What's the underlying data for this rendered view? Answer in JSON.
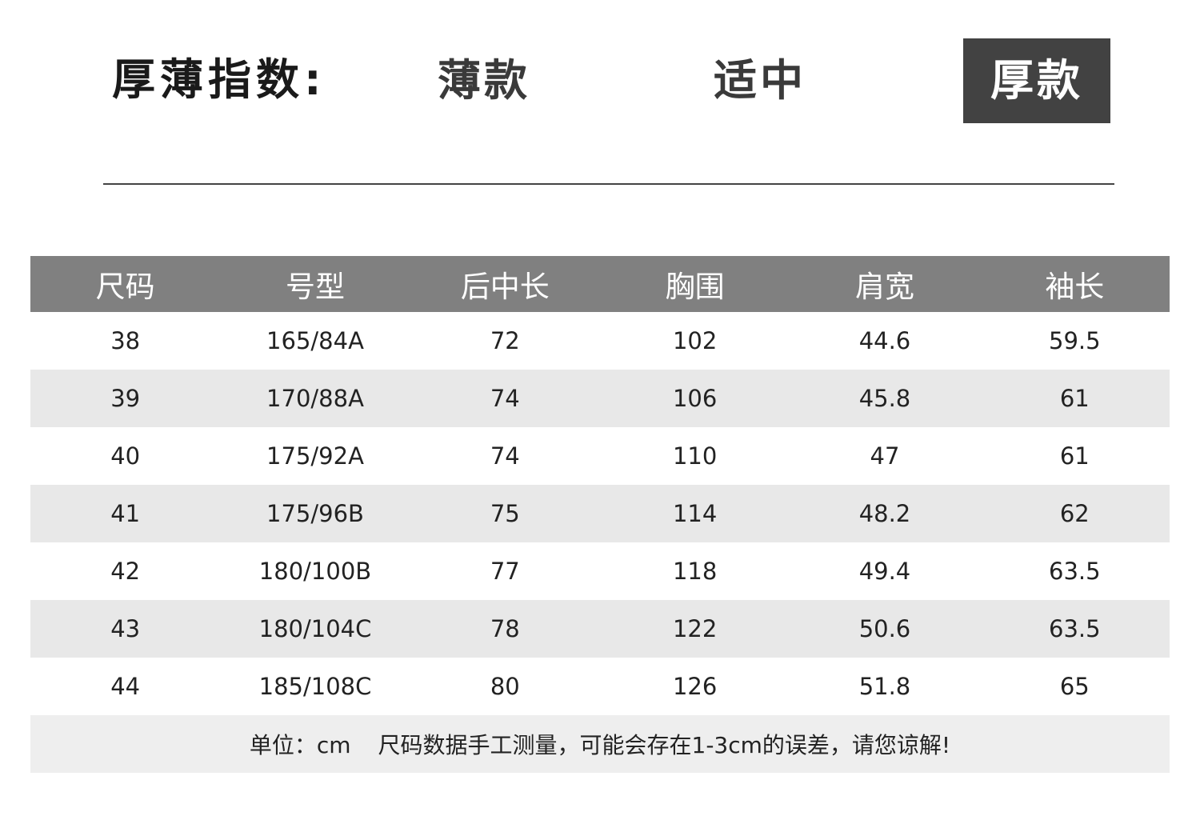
{
  "thickness": {
    "label": "厚薄指数:",
    "options": [
      "薄款",
      "适中",
      "厚款"
    ],
    "selected": "厚款"
  },
  "table": {
    "headers": [
      "尺码",
      "号型",
      "后中长",
      "胸围",
      "肩宽",
      "袖长"
    ],
    "rows": [
      [
        "38",
        "165/84A",
        "72",
        "102",
        "44.6",
        "59.5"
      ],
      [
        "39",
        "170/88A",
        "74",
        "106",
        "45.8",
        "61"
      ],
      [
        "40",
        "175/92A",
        "74",
        "110",
        "47",
        "61"
      ],
      [
        "41",
        "175/96B",
        "75",
        "114",
        "48.2",
        "62"
      ],
      [
        "42",
        "180/100B",
        "77",
        "118",
        "49.4",
        "63.5"
      ],
      [
        "43",
        "180/104C",
        "78",
        "122",
        "50.6",
        "63.5"
      ],
      [
        "44",
        "185/108C",
        "80",
        "126",
        "51.8",
        "65"
      ]
    ]
  },
  "note": {
    "unit": "单位：cm",
    "text": "尺码数据手工测量，可能会存在1-3cm的误差，请您谅解!"
  },
  "colors": {
    "header_bg": "#808080",
    "selected_bg": "#424242",
    "stripe_bg": "#e8e8e8"
  }
}
